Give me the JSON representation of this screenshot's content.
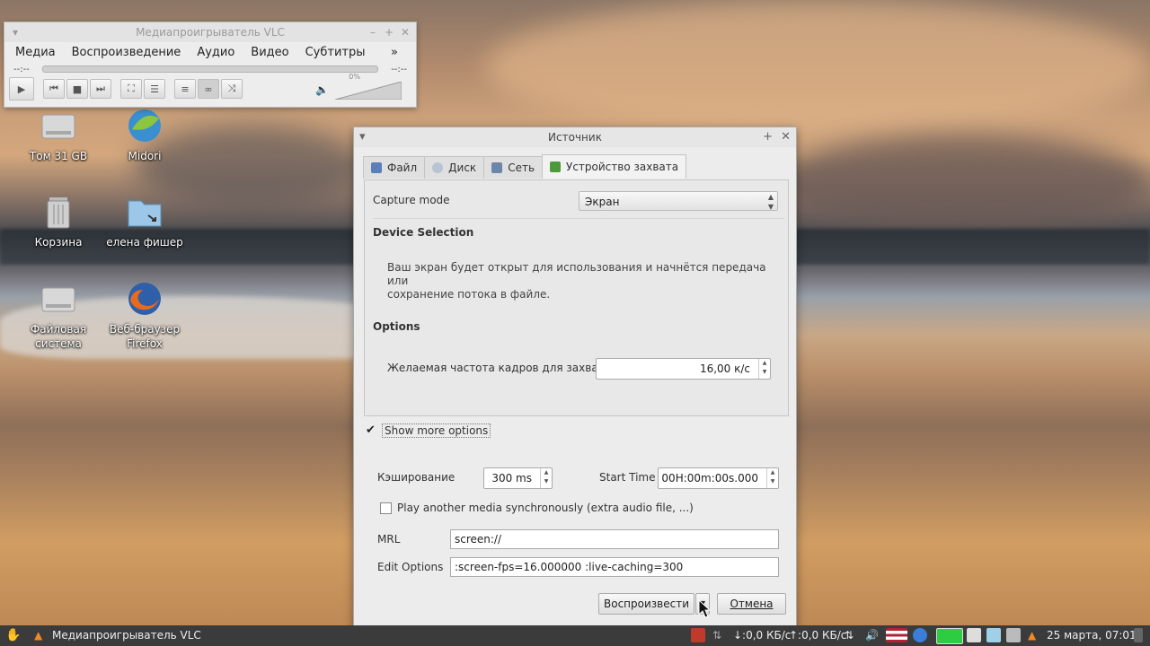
{
  "desktop": {
    "icons": [
      {
        "label": "Том 31 GB",
        "icon": "drive-icon"
      },
      {
        "label": "Midori",
        "icon": "midori-icon"
      },
      {
        "label": "Корзина",
        "icon": "trash-icon"
      },
      {
        "label": "елена фишер",
        "icon": "folder-icon"
      },
      {
        "label": "Файловая система",
        "icon": "drive-icon"
      },
      {
        "label": "Веб-браузер Firefox",
        "icon": "firefox-icon"
      }
    ]
  },
  "vlc": {
    "title": "Медиапроигрыватель VLC",
    "menu": [
      "Медиа",
      "Воспроизведение",
      "Аудио",
      "Видео",
      "Субтитры"
    ],
    "menu_more": "»",
    "time_left": "--:--",
    "time_right": "--:--",
    "volume_label": "0%"
  },
  "dialog": {
    "title": "Источник",
    "tabs": [
      {
        "label": "Файл",
        "icon": "file-icon"
      },
      {
        "label": "Диск",
        "icon": "disc-icon"
      },
      {
        "label": "Сеть",
        "icon": "network-icon"
      },
      {
        "label": "Устройство захвата",
        "icon": "capture-icon",
        "active": true
      }
    ],
    "capture_mode_label": "Capture mode",
    "capture_mode_value": "Экран",
    "device_selection_heading": "Device Selection",
    "device_description_line1": "Ваш экран будет открыт для использования и начнётся передача или",
    "device_description_line2": "сохранение потока в файле.",
    "options_heading": "Options",
    "framerate_label": "Желаемая частота кадров для захвата.",
    "framerate_value": "16,00 к/с",
    "show_more_label": "Show more options",
    "caching_label": "Кэширование",
    "caching_value": "300 ms",
    "start_time_label": "Start Time",
    "start_time_value": "00H:00m:00s.000",
    "sync_label": "Play another media synchronously (extra audio file, ...)",
    "mrl_label": "MRL",
    "mrl_value": "screen://",
    "edit_options_label": "Edit Options",
    "edit_options_value": ":screen-fps=16.000000 :live-caching=300",
    "play_button": "Воспроизвести",
    "cancel_button": "Отмена"
  },
  "taskbar": {
    "window_label": "Медиапроигрыватель VLC",
    "net_down": "↓:0,0 КБ/с",
    "net_up": "↑:0,0 КБ/с",
    "clock": "25 марта, 07:01"
  }
}
